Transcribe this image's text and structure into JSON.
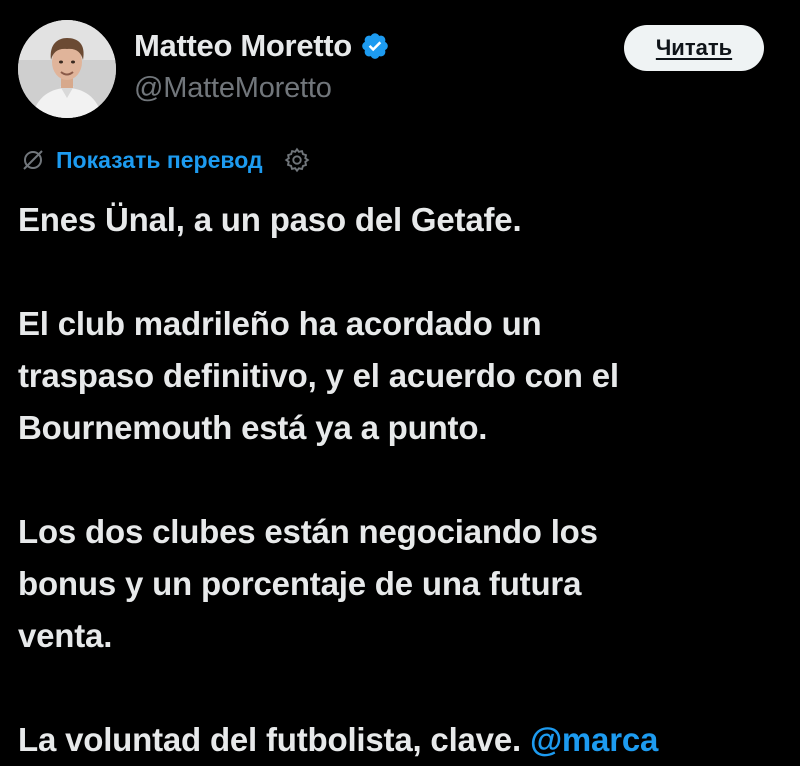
{
  "author": {
    "name": "Matteo Moretto",
    "handle": "@MatteMoretto",
    "verified_color": "#1d9bf0"
  },
  "follow_button": {
    "label": "Читать"
  },
  "translate": {
    "icon": "translate-off-icon",
    "label": "Показать перевод",
    "settings_icon": "gear-icon"
  },
  "tweet": {
    "line1": "Enes Ünal, a un paso del Getafe.",
    "line2": "El club madrileño ha acordado un",
    "line3": "traspaso definitivo, y el acuerdo con el",
    "line4": "Bournemouth está ya a punto.",
    "line5": "Los dos clubes están negociando los",
    "line6": "bonus y un porcentaje de una futura",
    "line7": "venta.",
    "line8": "La voluntad del futbolista, clave.",
    "mention": "@marca"
  },
  "colors": {
    "background": "#000000",
    "text": "#e7e9ea",
    "muted": "#71767b",
    "accent": "#1d9bf0"
  }
}
